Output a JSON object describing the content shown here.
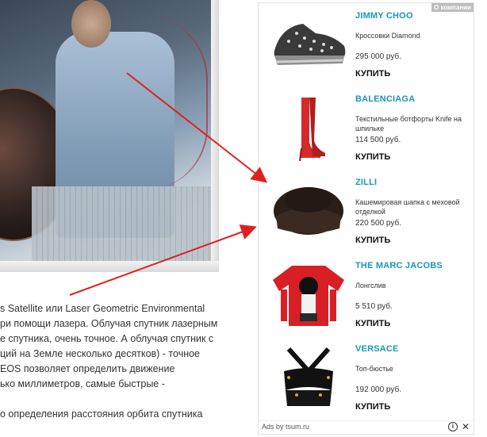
{
  "article": {
    "lines": [
      "s Satellite или Laser Geometric Environmental",
      "ри помощи лазера. Облучая спутник лазерным",
      "е спутника, очень точное. А облучая спутник с",
      "ций на Земле несколько десятков) - точное",
      "EOS позволяет определить движение",
      "ько миллиметров, самые быстрые -",
      "",
      "о определения расстояния орбита спутника"
    ]
  },
  "ad": {
    "badge": "О компании",
    "items": [
      {
        "brand": "JIMMY CHOO",
        "desc": "Кроссовки Diamond",
        "price": "295 000 руб.",
        "buy": "КУПИТЬ"
      },
      {
        "brand": "BALENCIAGA",
        "desc": "Текстильные ботфорты Knife на шпильке",
        "price": "114 500 руб.",
        "buy": "КУПИТЬ"
      },
      {
        "brand": "ZILLI",
        "desc": "Кашемировая шапка с меховой отделкой",
        "price": "220 500 руб.",
        "buy": "КУПИТЬ"
      },
      {
        "brand": "THE MARC JACOBS",
        "desc": "Лонгслив",
        "price": "5 510 руб.",
        "buy": "КУПИТЬ"
      },
      {
        "brand": "VERSACE",
        "desc": "Топ-бюстье",
        "price": "192 000 руб.",
        "buy": "КУПИТЬ"
      }
    ],
    "footer": {
      "source": "Ads by tsum.ru",
      "info_icon": "i",
      "close_icon": "✕"
    }
  },
  "colors": {
    "brand_link": "#1797b9",
    "arrow": "#e02020"
  }
}
